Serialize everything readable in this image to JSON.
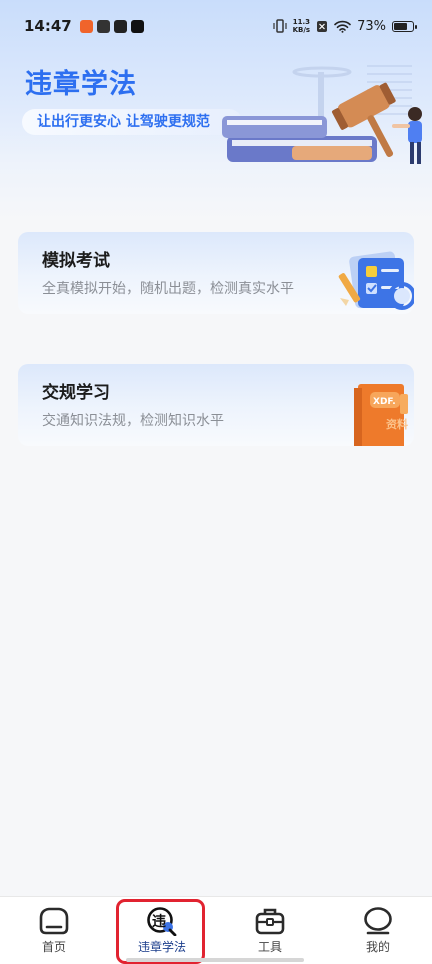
{
  "status_bar": {
    "time": "14:47",
    "net_speed_value": "11.3",
    "net_speed_unit": "KB/s",
    "battery": "73%"
  },
  "hero": {
    "title": "违章学法",
    "subtitle": "让出行更安心 让驾驶更规范"
  },
  "cards": [
    {
      "title": "模拟考试",
      "desc": "全真模拟开始，随机出题，检测真实水平"
    },
    {
      "title": "交规学习",
      "desc": "交通知识法规，检测知识水平",
      "illu_text": "XDF.",
      "illu_text2": "资料"
    }
  ],
  "bottom_nav": {
    "items": [
      {
        "label": "首页",
        "icon": "home-icon"
      },
      {
        "label": "违章学法",
        "icon": "violation-search-icon",
        "icon_text": "违"
      },
      {
        "label": "工具",
        "icon": "toolbox-icon"
      },
      {
        "label": "我的",
        "icon": "profile-icon"
      }
    ],
    "active_index": 1
  },
  "colors": {
    "accent": "#2d6ff0",
    "highlight": "#e12330"
  }
}
